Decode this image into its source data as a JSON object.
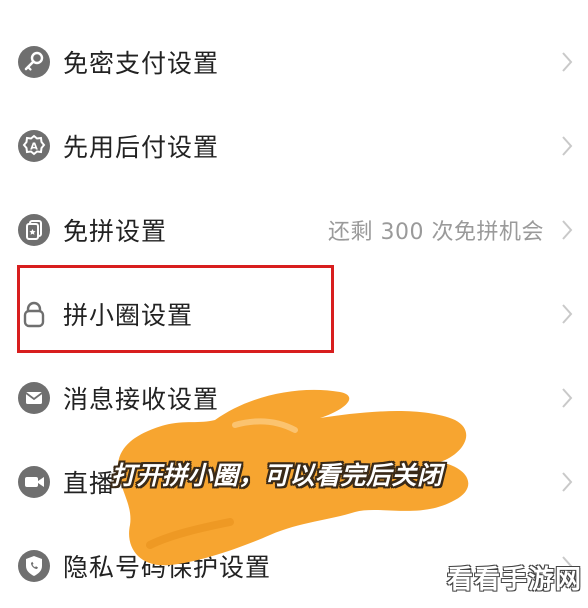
{
  "settings": {
    "items": [
      {
        "label": "免密支付设置",
        "icon": "key-icon",
        "value": ""
      },
      {
        "label": "先用后付设置",
        "icon": "badge-icon",
        "value": ""
      },
      {
        "label": "免拼设置",
        "icon": "cards-icon",
        "value": "还剩 300 次免拼机会"
      },
      {
        "label": "拼小圈设置",
        "icon": "lock-bag-icon",
        "value": ""
      },
      {
        "label": "消息接收设置",
        "icon": "envelope-icon",
        "value": ""
      },
      {
        "label": "直播",
        "icon": "video-camera-icon",
        "value": ""
      },
      {
        "label": "隐私号码保护设置",
        "icon": "shield-phone-icon",
        "value": ""
      }
    ]
  },
  "overlay": {
    "caption": "打开拼小圈，可以看完后关闭",
    "watermark": "看看手游网",
    "highlight_color": "#d81e1e",
    "blob_color": "#f7a530"
  },
  "colors": {
    "icon_gray": "#6f6f6f",
    "chevron": "#c9c9c9",
    "value_text": "#9a9a9a"
  }
}
